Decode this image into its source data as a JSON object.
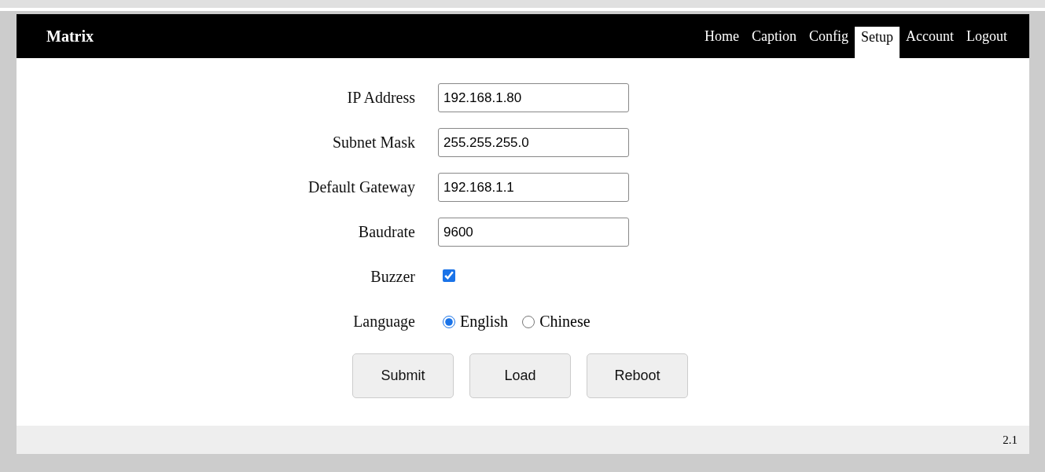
{
  "header": {
    "brand": "Matrix",
    "nav": [
      {
        "label": "Home",
        "selected": false
      },
      {
        "label": "Caption",
        "selected": false
      },
      {
        "label": "Config",
        "selected": false
      },
      {
        "label": "Setup",
        "selected": true
      },
      {
        "label": "Account",
        "selected": false
      },
      {
        "label": "Logout",
        "selected": false
      }
    ]
  },
  "form": [
    {
      "kind": "text",
      "label": "IP Address",
      "value": "192.168.1.80"
    },
    {
      "kind": "text",
      "label": "Subnet Mask",
      "value": "255.255.255.0"
    },
    {
      "kind": "text",
      "label": "Default Gateway",
      "value": "192.168.1.1"
    },
    {
      "kind": "text",
      "label": "Baudrate",
      "value": "9600"
    },
    {
      "kind": "checkbox",
      "label": "Buzzer",
      "checked": true
    },
    {
      "kind": "radio",
      "label": "Language",
      "options": [
        {
          "label": "English",
          "selected": true
        },
        {
          "label": "Chinese",
          "selected": false
        }
      ]
    }
  ],
  "buttons": [
    "Submit",
    "Load",
    "Reboot"
  ],
  "footer": {
    "version": "2.1"
  }
}
